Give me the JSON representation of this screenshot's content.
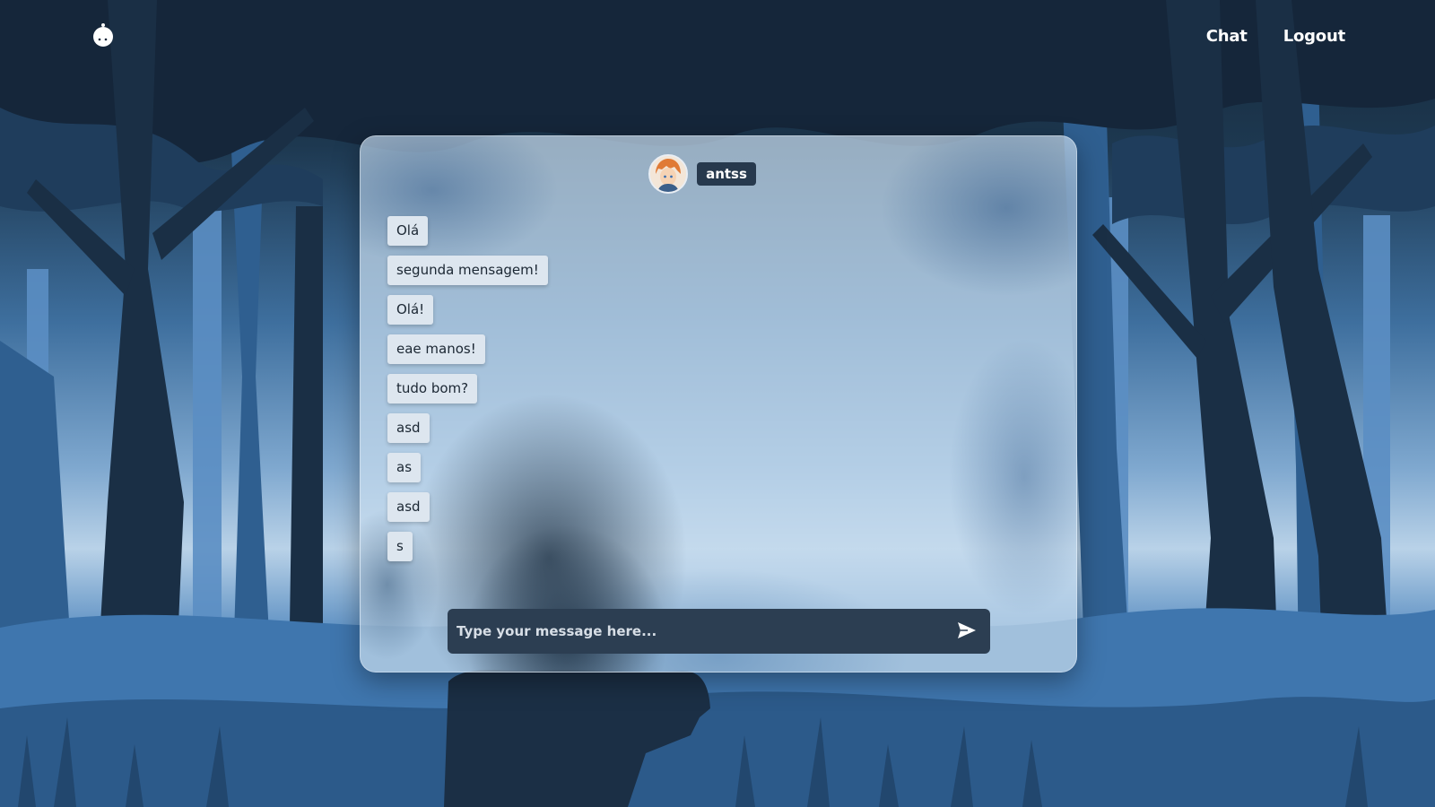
{
  "nav": {
    "links": [
      {
        "label": "Chat"
      },
      {
        "label": "Logout"
      }
    ]
  },
  "chat": {
    "username": "antss",
    "messages": [
      {
        "text": "Olá"
      },
      {
        "text": "segunda mensagem!"
      },
      {
        "text": "Olá!"
      },
      {
        "text": "eae manos!"
      },
      {
        "text": "tudo bom?"
      },
      {
        "text": "asd"
      },
      {
        "text": "as"
      },
      {
        "text": "asd"
      },
      {
        "text": "s"
      }
    ],
    "composer": {
      "placeholder": "Type your message here...",
      "value": ""
    }
  },
  "icons": {
    "logo": "ghost-logo-icon",
    "send": "send-icon",
    "avatar": "user-avatar"
  },
  "colors": {
    "composer_bg": "#2c3e52",
    "username_bg": "#27394d",
    "message_bg": "#dde6ef"
  }
}
